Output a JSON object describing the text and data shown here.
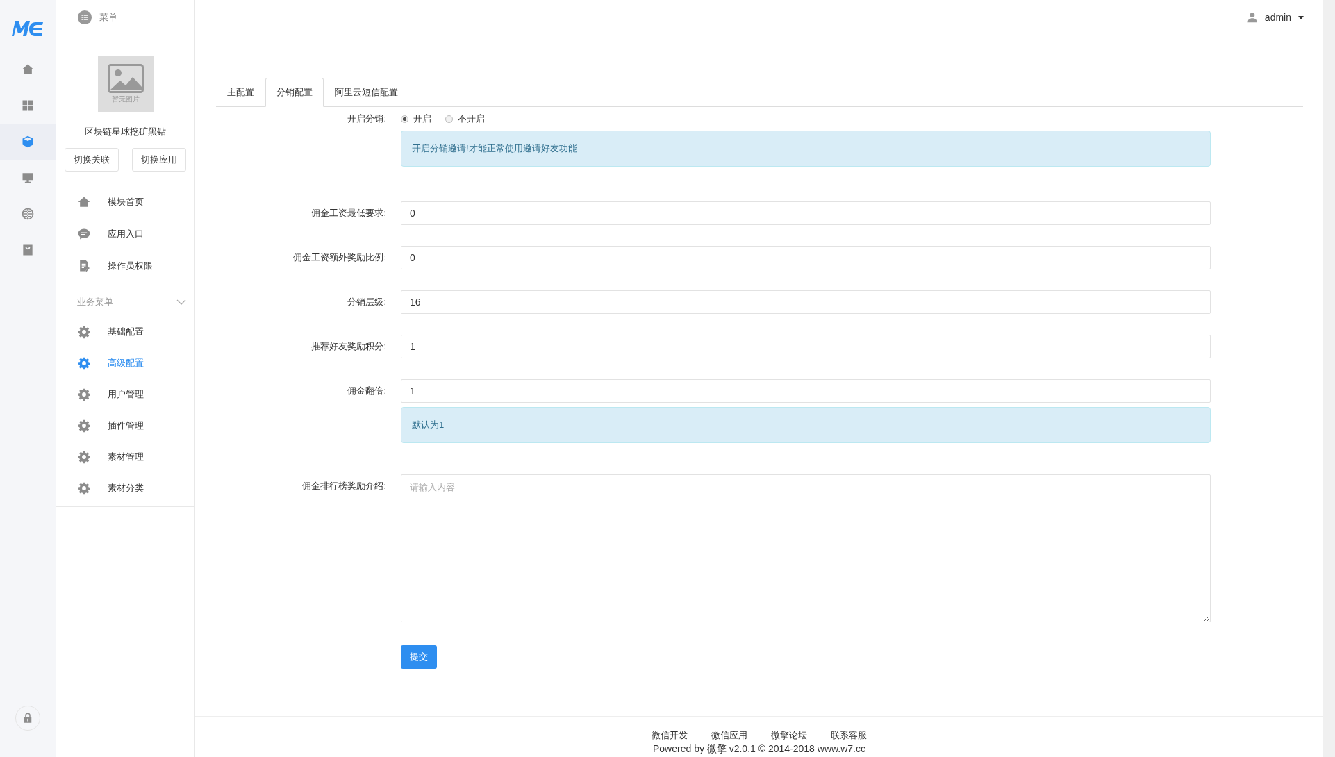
{
  "header": {
    "menu_label": "菜单",
    "user": "admin"
  },
  "rail": [
    {
      "selected": false
    },
    {
      "selected": false
    },
    {
      "selected": true
    },
    {
      "selected": false
    },
    {
      "selected": false
    },
    {
      "selected": false
    }
  ],
  "module": {
    "image_caption": "暂无图片",
    "name": "区块链星球挖矿黑钻",
    "buttons": [
      "切换关联",
      "切换应用"
    ]
  },
  "module_menu": [
    {
      "label": "模块首页",
      "selected": false
    },
    {
      "label": "应用入口",
      "selected": false
    },
    {
      "label": "操作员权限",
      "selected": false
    }
  ],
  "business_menu": {
    "title": "业务菜单",
    "expanded": true,
    "items": [
      {
        "label": "基础配置",
        "selected": false
      },
      {
        "label": "高级配置",
        "selected": true
      },
      {
        "label": "用户管理",
        "selected": false
      },
      {
        "label": "插件管理",
        "selected": false
      },
      {
        "label": "素材管理",
        "selected": false
      },
      {
        "label": "素材分类",
        "selected": false
      }
    ]
  },
  "tabs": [
    {
      "label": "主配置",
      "selected": false
    },
    {
      "label": "分销配置",
      "selected": true
    },
    {
      "label": "阿里云短信配置",
      "selected": false
    }
  ],
  "form": [
    {
      "kind": "radio",
      "label": "开启分销:",
      "options": [
        {
          "label": "开启",
          "selected": true
        },
        {
          "label": "不开启",
          "selected": false
        }
      ],
      "help": "开启分销邀请!才能正常使用邀请好友功能"
    },
    {
      "kind": "input",
      "label": "佣金工资最低要求:",
      "value": "0"
    },
    {
      "kind": "input",
      "label": "佣金工资额外奖励比例:",
      "value": "0"
    },
    {
      "kind": "input",
      "label": "分销层级:",
      "value": "16"
    },
    {
      "kind": "input",
      "label": "推荐好友奖励积分:",
      "value": "1"
    },
    {
      "kind": "input",
      "label": "佣金翻倍:",
      "value": "1",
      "help": "默认为1"
    },
    {
      "kind": "textarea",
      "label": "佣金排行榜奖励介绍:",
      "placeholder": "请输入内容"
    }
  ],
  "submit": "提交",
  "footer": {
    "links": [
      "微信开发",
      "微信应用",
      "微擎论坛",
      "联系客服"
    ],
    "copyright": "Powered by 微擎 v2.0.1 © 2014-2018 www.w7.cc"
  }
}
